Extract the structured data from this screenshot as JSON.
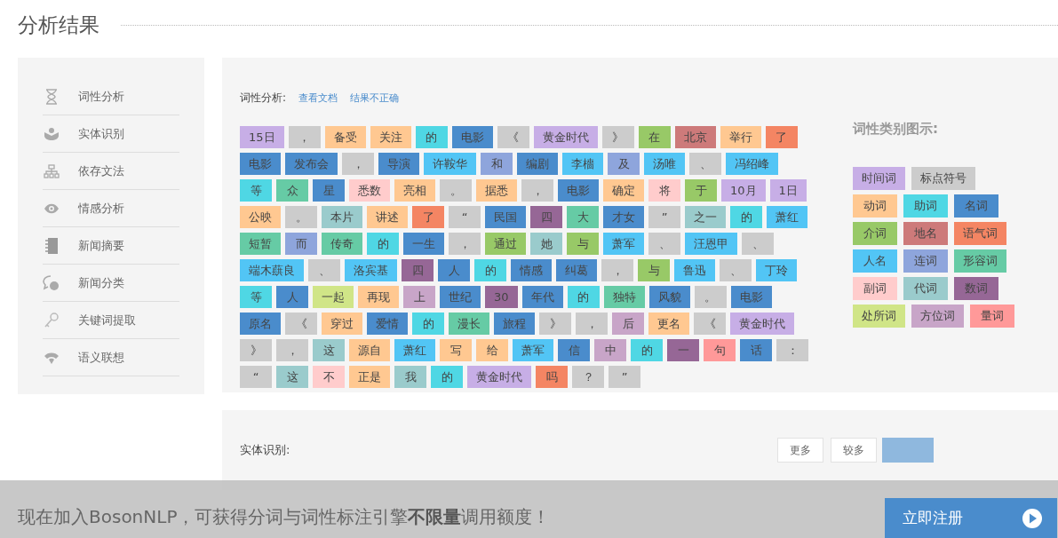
{
  "page_title": "分析结果",
  "sidebar": {
    "items": [
      {
        "label": "词性分析"
      },
      {
        "label": "实体识别"
      },
      {
        "label": "依存文法"
      },
      {
        "label": "情感分析"
      },
      {
        "label": "新闻摘要"
      },
      {
        "label": "新闻分类"
      },
      {
        "label": "关键词提取"
      },
      {
        "label": "语义联想"
      }
    ]
  },
  "pos_panel": {
    "label": "词性分析:",
    "links": [
      "查看文档",
      "结果不正确"
    ],
    "token_rows": [
      [
        {
          "text": "15日",
          "color": "#c7aee6"
        },
        {
          "text": "，",
          "color": "#cccccc"
        },
        {
          "text": "备受",
          "color": "#ffc891"
        },
        {
          "text": "关注",
          "color": "#ffc891"
        },
        {
          "text": "的",
          "color": "#4fd7e4"
        },
        {
          "text": "电影",
          "color": "#4a8ccc"
        },
        {
          "text": "《",
          "color": "#cccccc"
        },
        {
          "text": "黄金时代",
          "color": "#c7aee6"
        },
        {
          "text": "》",
          "color": "#cccccc"
        },
        {
          "text": "在",
          "color": "#98c967"
        },
        {
          "text": "北京",
          "color": "#cd7a7a"
        },
        {
          "text": "举行",
          "color": "#ffc891"
        },
        {
          "text": "了",
          "color": "#f48563"
        }
      ],
      [
        {
          "text": "电影",
          "color": "#4a8ccc"
        },
        {
          "text": "发布会",
          "color": "#4a8ccc"
        },
        {
          "text": "，",
          "color": "#cccccc"
        },
        {
          "text": "导演",
          "color": "#4a8ccc"
        },
        {
          "text": "许鞍华",
          "color": "#52c5f5"
        },
        {
          "text": "和",
          "color": "#8ea5dc"
        },
        {
          "text": "编剧",
          "color": "#4a8ccc"
        },
        {
          "text": "李檣",
          "color": "#52c5f5"
        },
        {
          "text": "及",
          "color": "#8ea5dc"
        },
        {
          "text": "汤唯",
          "color": "#52c5f5"
        },
        {
          "text": "、",
          "color": "#cccccc"
        },
        {
          "text": "冯绍峰",
          "color": "#52c5f5"
        }
      ],
      [
        {
          "text": "等",
          "color": "#4fd7e4"
        },
        {
          "text": "众",
          "color": "#66cba5"
        },
        {
          "text": "星",
          "color": "#4a8ccc"
        },
        {
          "text": "悉数",
          "color": "#ffcccc"
        },
        {
          "text": "亮相",
          "color": "#ffc891"
        },
        {
          "text": "。",
          "color": "#cccccc"
        },
        {
          "text": "据悉",
          "color": "#ffc891"
        },
        {
          "text": "，",
          "color": "#cccccc"
        },
        {
          "text": "电影",
          "color": "#4a8ccc"
        },
        {
          "text": "确定",
          "color": "#ffc891"
        },
        {
          "text": "将",
          "color": "#ffcccc"
        },
        {
          "text": "于",
          "color": "#98c967"
        },
        {
          "text": "10月",
          "color": "#c7aee6"
        },
        {
          "text": "1日",
          "color": "#c7aee6"
        }
      ],
      [
        {
          "text": "公映",
          "color": "#ffc891"
        },
        {
          "text": "。",
          "color": "#cccccc"
        },
        {
          "text": "本片",
          "color": "#9acbcc"
        },
        {
          "text": "讲述",
          "color": "#ffc891"
        },
        {
          "text": "了",
          "color": "#f48563"
        },
        {
          "text": "“",
          "color": "#cccccc"
        },
        {
          "text": "民国",
          "color": "#4a8ccc"
        },
        {
          "text": "四",
          "color": "#966796"
        },
        {
          "text": "大",
          "color": "#66cba5"
        },
        {
          "text": "才女",
          "color": "#4a8ccc"
        },
        {
          "text": "”",
          "color": "#cccccc"
        },
        {
          "text": "之一",
          "color": "#9acbcc"
        },
        {
          "text": "的",
          "color": "#4fd7e4"
        },
        {
          "text": "萧红",
          "color": "#52c5f5"
        }
      ],
      [
        {
          "text": "短暂",
          "color": "#66cba5"
        },
        {
          "text": "而",
          "color": "#8ea5dc"
        },
        {
          "text": "传奇",
          "color": "#66cba5"
        },
        {
          "text": "的",
          "color": "#4fd7e4"
        },
        {
          "text": "一生",
          "color": "#4a8ccc"
        },
        {
          "text": "，",
          "color": "#cccccc"
        },
        {
          "text": "通过",
          "color": "#98c967"
        },
        {
          "text": "她",
          "color": "#9acbcc"
        },
        {
          "text": "与",
          "color": "#98c967"
        },
        {
          "text": "萧军",
          "color": "#52c5f5"
        },
        {
          "text": "、",
          "color": "#cccccc"
        },
        {
          "text": "汪恩甲",
          "color": "#52c5f5"
        },
        {
          "text": "、",
          "color": "#cccccc"
        }
      ],
      [
        {
          "text": "端木蕻良",
          "color": "#52c5f5"
        },
        {
          "text": "、",
          "color": "#cccccc"
        },
        {
          "text": "洛宾基",
          "color": "#52c5f5"
        },
        {
          "text": "四",
          "color": "#966796"
        },
        {
          "text": "人",
          "color": "#4a8ccc"
        },
        {
          "text": "的",
          "color": "#4fd7e4"
        },
        {
          "text": "情感",
          "color": "#4a8ccc"
        },
        {
          "text": "纠葛",
          "color": "#4a8ccc"
        },
        {
          "text": "，",
          "color": "#cccccc"
        },
        {
          "text": "与",
          "color": "#98c967"
        },
        {
          "text": "鲁迅",
          "color": "#52c5f5"
        },
        {
          "text": "、",
          "color": "#cccccc"
        },
        {
          "text": "丁玲",
          "color": "#52c5f5"
        }
      ],
      [
        {
          "text": "等",
          "color": "#4fd7e4"
        },
        {
          "text": "人",
          "color": "#4a8ccc"
        },
        {
          "text": "一起",
          "color": "#d0e587"
        },
        {
          "text": "再现",
          "color": "#ffc891"
        },
        {
          "text": "上",
          "color": "#c8a5c8"
        },
        {
          "text": "世纪",
          "color": "#4a8ccc"
        },
        {
          "text": "30",
          "color": "#966796"
        },
        {
          "text": "年代",
          "color": "#4a8ccc"
        },
        {
          "text": "的",
          "color": "#4fd7e4"
        },
        {
          "text": "独特",
          "color": "#66cba5"
        },
        {
          "text": "风貌",
          "color": "#4a8ccc"
        },
        {
          "text": "。",
          "color": "#cccccc"
        },
        {
          "text": "电影",
          "color": "#4a8ccc"
        }
      ],
      [
        {
          "text": "原名",
          "color": "#4a8ccc"
        },
        {
          "text": "《",
          "color": "#cccccc"
        },
        {
          "text": "穿过",
          "color": "#ffc891"
        },
        {
          "text": "爱情",
          "color": "#4a8ccc"
        },
        {
          "text": "的",
          "color": "#4fd7e4"
        },
        {
          "text": "漫长",
          "color": "#66cba5"
        },
        {
          "text": "旅程",
          "color": "#4a8ccc"
        },
        {
          "text": "》",
          "color": "#cccccc"
        },
        {
          "text": "，",
          "color": "#cccccc"
        },
        {
          "text": "后",
          "color": "#c8a5c8"
        },
        {
          "text": "更名",
          "color": "#ffc891"
        },
        {
          "text": "《",
          "color": "#cccccc"
        },
        {
          "text": "黄金时代",
          "color": "#c7aee6"
        }
      ],
      [
        {
          "text": "》",
          "color": "#cccccc"
        },
        {
          "text": "，",
          "color": "#cccccc"
        },
        {
          "text": "这",
          "color": "#9acbcc"
        },
        {
          "text": "源自",
          "color": "#ffc891"
        },
        {
          "text": "萧红",
          "color": "#52c5f5"
        },
        {
          "text": "写",
          "color": "#ffc891"
        },
        {
          "text": "给",
          "color": "#ffc891"
        },
        {
          "text": "萧军",
          "color": "#52c5f5"
        },
        {
          "text": "信",
          "color": "#4a8ccc"
        },
        {
          "text": "中",
          "color": "#c8a5c8"
        },
        {
          "text": "的",
          "color": "#4fd7e4"
        },
        {
          "text": "一",
          "color": "#966796"
        },
        {
          "text": "句",
          "color": "#ff9999"
        },
        {
          "text": "话",
          "color": "#4a8ccc"
        },
        {
          "text": "：",
          "color": "#cccccc"
        }
      ],
      [
        {
          "text": "“",
          "color": "#cccccc"
        },
        {
          "text": "这",
          "color": "#9acbcc"
        },
        {
          "text": "不",
          "color": "#ffcccc"
        },
        {
          "text": "正是",
          "color": "#ffc891"
        },
        {
          "text": "我",
          "color": "#9acbcc"
        },
        {
          "text": "的",
          "color": "#4fd7e4"
        },
        {
          "text": "黄金时代",
          "color": "#c7aee6"
        },
        {
          "text": "吗",
          "color": "#f48563"
        },
        {
          "text": "？",
          "color": "#cccccc"
        },
        {
          "text": "”",
          "color": "#cccccc"
        }
      ]
    ],
    "legend": {
      "title": "词性类别图示:",
      "rows": [
        [
          {
            "label": "时间词",
            "color": "#c7aee6"
          },
          {
            "label": "标点符号",
            "color": "#cccccc"
          }
        ],
        [
          {
            "label": "动词",
            "color": "#ffc891"
          },
          {
            "label": "助词",
            "color": "#4fd7e4"
          },
          {
            "label": "名词",
            "color": "#4a8ccc"
          }
        ],
        [
          {
            "label": "介词",
            "color": "#98c967"
          },
          {
            "label": "地名",
            "color": "#cd7a7a"
          },
          {
            "label": "语气词",
            "color": "#f48563"
          }
        ],
        [
          {
            "label": "人名",
            "color": "#52c5f5"
          },
          {
            "label": "连词",
            "color": "#8ea5dc"
          },
          {
            "label": "形容词",
            "color": "#66cba5"
          }
        ],
        [
          {
            "label": "副词",
            "color": "#ffcccc"
          },
          {
            "label": "代词",
            "color": "#9acbcc"
          },
          {
            "label": "数词",
            "color": "#966796"
          }
        ],
        [
          {
            "label": "处所词",
            "color": "#d0e587"
          },
          {
            "label": "方位词",
            "color": "#c8a5c8"
          },
          {
            "label": "量词",
            "color": "#ff9999"
          }
        ]
      ]
    }
  },
  "entity_panel": {
    "label": "实体识别:",
    "buttons": [
      "更多",
      "较多"
    ]
  },
  "promo_bar": {
    "text": "现在加入BosonNLP，可获得分词与词性标注引擎**不限量**调用额度！",
    "button": "立即注册"
  }
}
